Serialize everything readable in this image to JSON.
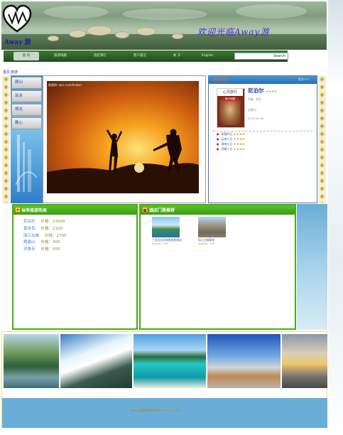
{
  "header": {
    "logo_text": "Away 游",
    "welcome": "欢迎光临Away游"
  },
  "nav": {
    "items": [
      {
        "label": "首 页",
        "active": true
      },
      {
        "label": "旅游线路",
        "active": false
      },
      {
        "label": "酒店预订",
        "active": false
      },
      {
        "label": "客户留言",
        "active": false
      },
      {
        "label": "关 于",
        "active": false
      },
      {
        "label": "English",
        "active": false
      }
    ],
    "search_label": "Search"
  },
  "breadcrumb": [
    "首页",
    "旅游"
  ],
  "left_menu": [
    "爬山",
    "玩水",
    "观光",
    "散心"
  ],
  "photo_caption": "昵图网 nipic.com/lindacr",
  "right_panel": {
    "header_title": "全部推荐",
    "more": "更多>>",
    "book": {
      "series": "心灵旅行",
      "tag": "尼泊尔",
      "red_label": "旅行地图",
      "title": "尼泊尔",
      "author": "作者：佚名",
      "publisher": "出版社：",
      "date": "2012-05-08"
    },
    "items": [
      {
        "name": "新疆四日"
      },
      {
        "name": "云南七日"
      },
      {
        "name": "海南五日"
      },
      {
        "name": "西藏十日"
      }
    ]
  },
  "hot_lines": {
    "title": "当季旅游热卖",
    "rows": [
      {
        "name": "尼泊尔",
        "price": "价格：13000"
      },
      {
        "name": "普吉岛",
        "price": "价格：2100"
      },
      {
        "name": "丽江古城",
        "price": "价格：2700"
      },
      {
        "name": "峨眉山",
        "price": "价格：300"
      },
      {
        "name": "灵泉寺",
        "price": "价格：500"
      }
    ]
  },
  "hotels": {
    "title": "酒店门票推荐",
    "items": [
      {
        "name": "三亚亚龙湾海景度假酒店",
        "sub": "Away价：560"
      },
      {
        "name": "丽江古城客栈",
        "sub": "Away价：260"
      }
    ]
  },
  "footer": {
    "text": "Away旅游网版权所有 2012-2013"
  },
  "colors": {
    "accent_green": "#4aaa18",
    "nav_green": "#1f4d1d",
    "link_blue": "#1a3fa8",
    "footer_blue": "#6aaed8"
  }
}
